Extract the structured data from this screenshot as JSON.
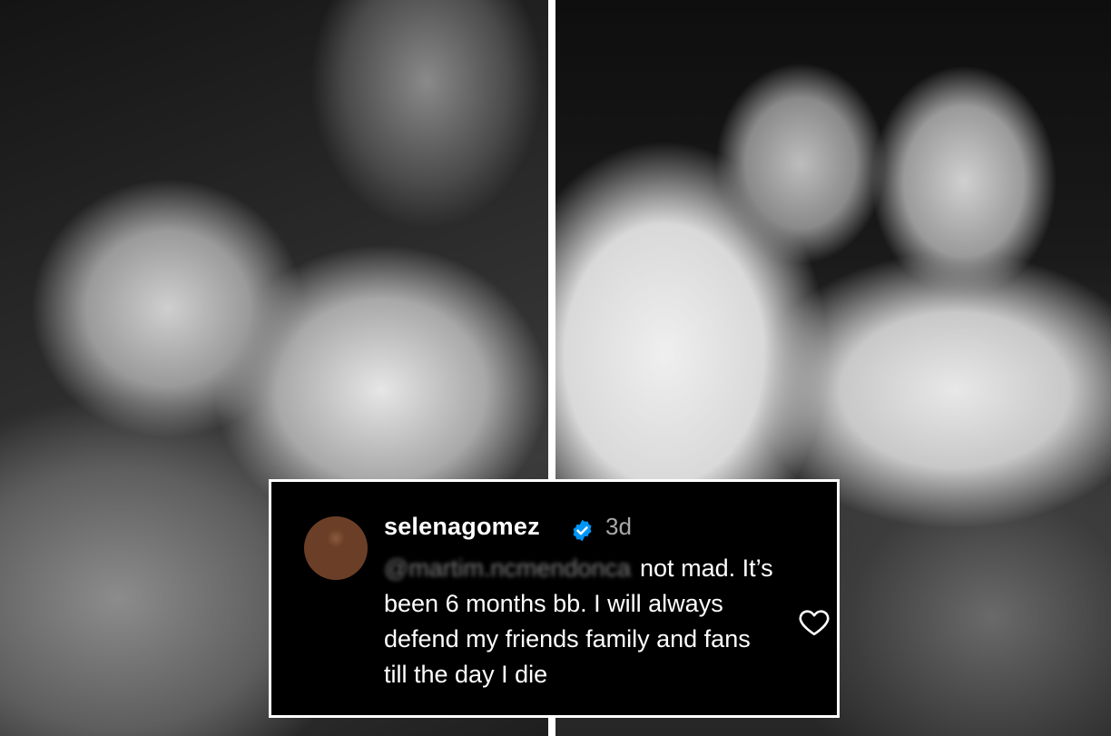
{
  "comment": {
    "username": "selenagomez",
    "verified": true,
    "timestamp": "3d",
    "mention": "@martim.ncmendonca",
    "text_first": "not",
    "text_rest": "mad. It’s been 6 months bb. I will always defend my friends family and fans till the day I die",
    "icons": {
      "verified": "verified-badge-icon",
      "like": "heart-outline-icon"
    },
    "colors": {
      "background": "#000000",
      "verified_badge": "#0095f6",
      "timestamp": "#a8a8a8"
    }
  }
}
